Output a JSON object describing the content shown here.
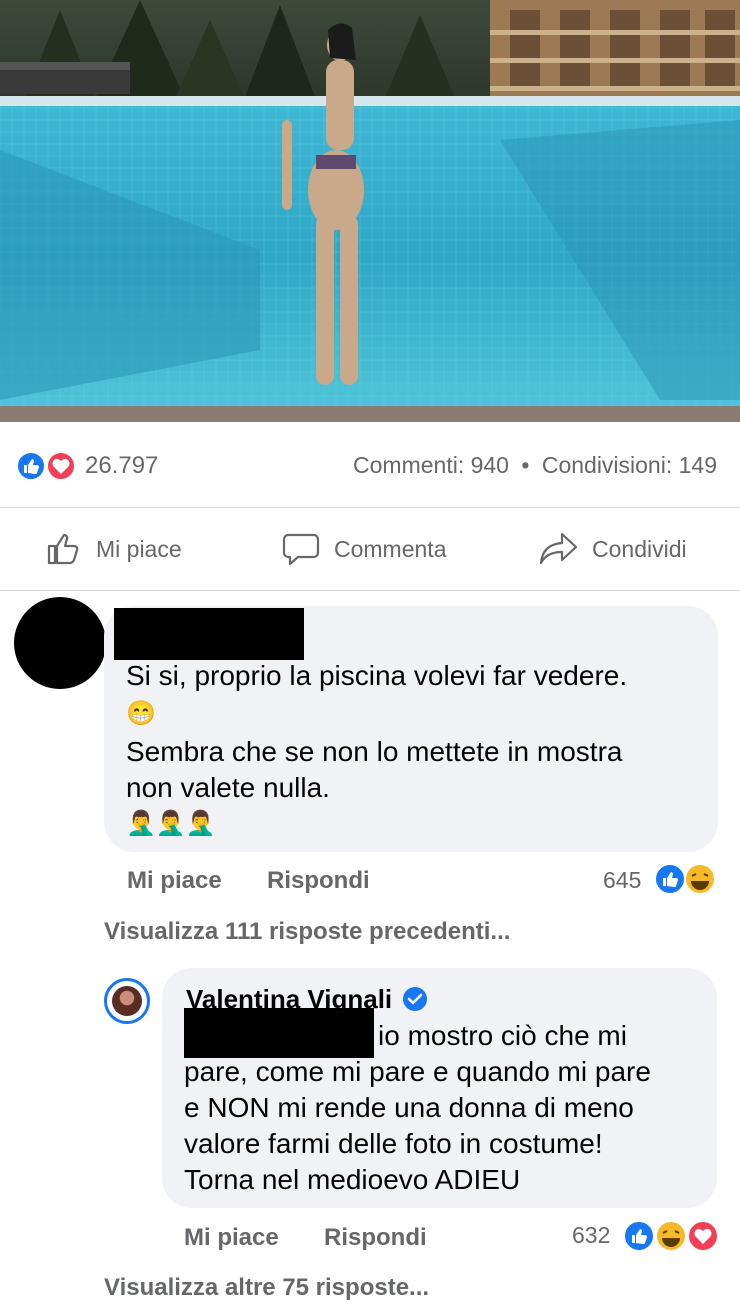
{
  "post": {
    "likes": "26.797",
    "comments": "Commenti: 940",
    "shares": "Condivisioni: 149",
    "separator": "•"
  },
  "actions": {
    "like": "Mi piace",
    "comment": "Commenta",
    "share": "Condividi"
  },
  "comment1": {
    "line1": "Si si, proprio la piscina volevi far vedere.",
    "emoji1": "😁",
    "line2": "Sembra che se non lo mettete in mostra",
    "line3": "non valete nulla.",
    "emoji2": "🤦‍♂️🤦‍♂️🤦‍♂️",
    "like_label": "Mi piace",
    "reply_label": "Rispondi",
    "reactions_count": "645"
  },
  "view_previous": "Visualizza 111 risposte precedenti...",
  "reply": {
    "author": "Valentina Vignali",
    "line1": "io mostro ciò che mi",
    "line2": "pare, come mi pare e quando mi pare",
    "line3": "e NON mi rende una donna di meno",
    "line4": "valore farmi delle foto in costume!",
    "line5": "Torna nel medioevo ADIEU",
    "like_label": "Mi piace",
    "reply_label": "Rispondi",
    "reactions_count": "632"
  },
  "view_more": "Visualizza altre 75 risposte...",
  "colors": {
    "facebook_blue": "#1877f2",
    "love_red": "#f33e58",
    "haha_yellow": "#f7b928",
    "secondary_text": "#65676b",
    "bubble_bg": "#f0f2f5"
  }
}
